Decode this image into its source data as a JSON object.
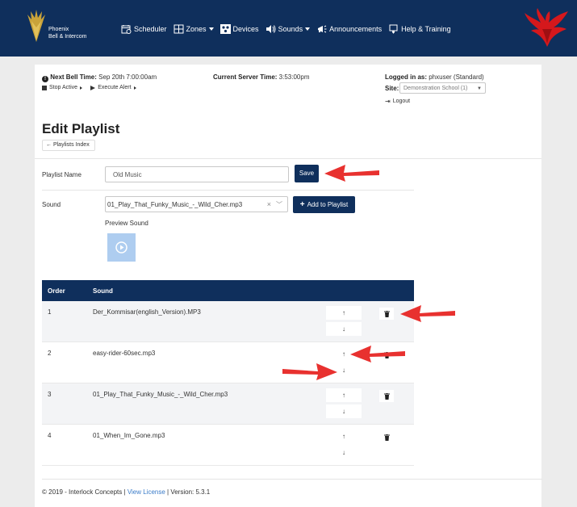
{
  "brand": {
    "line1": "Phoenix",
    "line2": "Bell & Intercom"
  },
  "nav": [
    {
      "label": "Scheduler",
      "caret": false,
      "icon": "calendar-clock-icon"
    },
    {
      "label": "Zones",
      "caret": true,
      "icon": "zones-grid-icon"
    },
    {
      "label": "Devices",
      "caret": false,
      "icon": "devices-icon"
    },
    {
      "label": "Sounds",
      "caret": true,
      "icon": "speaker-icon"
    },
    {
      "label": "Announcements",
      "caret": false,
      "icon": "megaphone-icon"
    },
    {
      "label": "Help & Training",
      "caret": false,
      "icon": "help-icon"
    }
  ],
  "status": {
    "next_bell_label": "Next Bell Time:",
    "next_bell_value": "Sep 20th 7:00:00am",
    "stop_active": "Stop Active",
    "execute_alert": "Execute Alert",
    "server_time_label": "Current Server Time:",
    "server_time_value": "3:53:00pm",
    "logged_in_label": "Logged in as:",
    "logged_in_value": "phxuser (Standard)",
    "site_label": "Site:",
    "site_value": "Demonstration School (1)",
    "logout": "Logout"
  },
  "page": {
    "title": "Edit Playlist",
    "breadcrumb": "Playlists Index",
    "playlist_name_label": "Playlist Name",
    "playlist_name_value": "Old Music",
    "save_label": "Save",
    "sound_label": "Sound",
    "sound_value": "01_Play_That_Funky_Music_-_Wild_Cher.mp3",
    "add_label": "Add to Playlist",
    "preview_label": "Preview Sound"
  },
  "table": {
    "headers": [
      "Order",
      "Sound"
    ],
    "rows": [
      {
        "order": "1",
        "sound": "Der_Kommisar(english_Version).MP3",
        "has_trash": true
      },
      {
        "order": "2",
        "sound": "easy-rider-60sec.mp3",
        "has_trash": true
      },
      {
        "order": "3",
        "sound": "01_Play_That_Funky_Music_-_Wild_Cher.mp3",
        "has_trash": true
      },
      {
        "order": "4",
        "sound": "01_When_Im_Gone.mp3",
        "has_trash": true
      }
    ]
  },
  "footer": {
    "prefix": "© 2019 - Interlock Concepts | ",
    "license_link": "View License",
    "suffix": " | Version: 5.3.1"
  },
  "colors": {
    "navy": "#0f2f5c",
    "annotation_red": "#e8312f",
    "link": "#3a7bc8"
  }
}
